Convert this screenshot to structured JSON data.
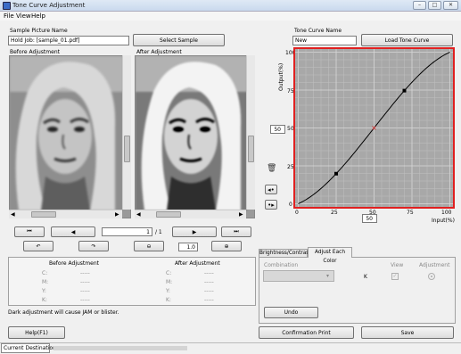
{
  "window": {
    "title": "Tone Curve Adjustment",
    "minimize": "–",
    "maximize": "□",
    "close": "✕"
  },
  "menu": [
    "File",
    "View",
    "Help"
  ],
  "sample": {
    "label": "Sample Picture Name",
    "value": "Hold Job: [sample_01.pdf]",
    "select_button": "Select Sample"
  },
  "tone_curve": {
    "label": "Tone Curve Name",
    "value": "New",
    "load_button": "Load Tone Curve",
    "x_label": "Input(%)",
    "y_label": "Output(%)",
    "x_ticks": [
      "0",
      "25",
      "50",
      "75",
      "100"
    ],
    "y_ticks": [
      "0",
      "25",
      "50",
      "75",
      "100"
    ],
    "input_value": "50",
    "output_value": "50"
  },
  "before_label": "Before Adjustment",
  "after_label": "After Adjustment",
  "nav": {
    "page_value": "1",
    "page_total": "/ 1",
    "zoom": "1.0"
  },
  "density": {
    "before_title": "Before Adjustment",
    "after_title": "After Adjustment",
    "rows": [
      {
        "label": "C:",
        "before": "-----",
        "after": "-----"
      },
      {
        "label": "M:",
        "before": "-----",
        "after": "-----"
      },
      {
        "label": "Y:",
        "before": "-----",
        "after": "-----"
      },
      {
        "label": "K:",
        "before": "-----",
        "after": "-----"
      }
    ]
  },
  "warning": "Dark adjustment will cause JAM or blister.",
  "tabs": [
    "Brightness/Contrast",
    "Adjust Each Color"
  ],
  "adjust_each": {
    "combination_label": "Combination",
    "view_label": "View",
    "adjustment_label": "Adjustment",
    "channel": "K",
    "undo_button": "Undo"
  },
  "buttons": {
    "help": "Help(F1)",
    "confirm": "Confirmation Print",
    "save": "Save"
  },
  "status": {
    "current_destination_label": "Current Destination",
    "destination_value": ""
  },
  "colors": {
    "graph_border": "#e02020",
    "graph_bg": "#a8a8a8",
    "selected_point": "#e02020"
  }
}
